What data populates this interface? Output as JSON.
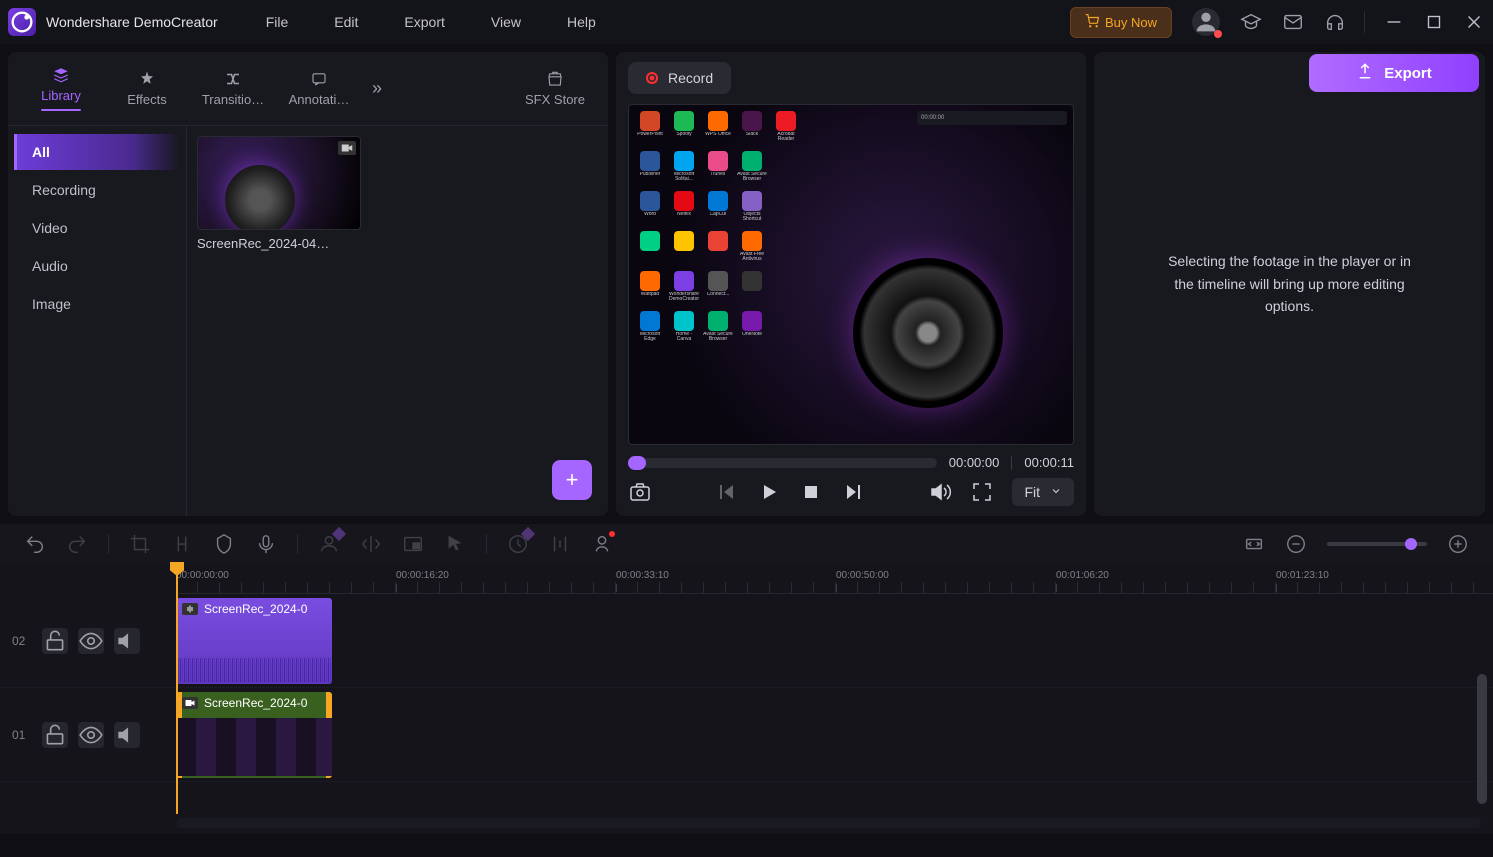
{
  "app": {
    "title": "Wondershare DemoCreator"
  },
  "menu": {
    "file": "File",
    "edit": "Edit",
    "export": "Export",
    "view": "View",
    "help": "Help"
  },
  "titlebar": {
    "buy": "Buy Now"
  },
  "export_btn": "Export",
  "tabs": {
    "library": "Library",
    "effects": "Effects",
    "transitions": "Transitio…",
    "annotations": "Annotati…",
    "sfx": "SFX Store"
  },
  "categories": {
    "all": "All",
    "recording": "Recording",
    "video": "Video",
    "audio": "Audio",
    "image": "Image"
  },
  "media": {
    "item1": "ScreenRec_2024-04…"
  },
  "record": {
    "label": "Record"
  },
  "player": {
    "current": "00:00:00",
    "total": "00:00:11",
    "fit": "Fit"
  },
  "properties": {
    "hint": "Selecting the footage in the player or in the timeline will bring up more editing options."
  },
  "ruler": {
    "t0": "00:00:00:00",
    "t1": "00:00:16:20",
    "t2": "00:00:33:10",
    "t3": "00:00:50:00",
    "t4": "00:01:06:20",
    "t5": "00:01:23:10"
  },
  "tracks": {
    "n2": "02",
    "n1": "01",
    "clip_audio": "ScreenRec_2024-0",
    "clip_video": "ScreenRec_2024-0"
  },
  "desktop_icons": [
    {
      "c": "#d24726",
      "l": "PowerPoint"
    },
    {
      "c": "#1db954",
      "l": "Spotify"
    },
    {
      "c": "#ff6a00",
      "l": "WPS Office"
    },
    {
      "c": "#4a154b",
      "l": "Slack"
    },
    {
      "c": "#ed1c24",
      "l": "Acrobat Reader"
    },
    {
      "c": "#2b579a",
      "l": "Publisher"
    },
    {
      "c": "#00a4ef",
      "l": "Microsoft Solitai..."
    },
    {
      "c": "#ea4c89",
      "l": "iTunes"
    },
    {
      "c": "#00b06f",
      "l": "Avast Secure Browser"
    },
    {
      "c": "",
      "l": ""
    },
    {
      "c": "#2b579a",
      "l": "Word"
    },
    {
      "c": "#e50914",
      "l": "Netflix"
    },
    {
      "c": "#0078d4",
      "l": "CapCut"
    },
    {
      "c": "#8661c5",
      "l": "Objects Shortcut"
    },
    {
      "c": "",
      "l": ""
    },
    {
      "c": "#00d084",
      "l": ""
    },
    {
      "c": "#ffc400",
      "l": ""
    },
    {
      "c": "#ea4335",
      "l": ""
    },
    {
      "c": "#ff6a00",
      "l": "Avast Free Antivirus"
    },
    {
      "c": "",
      "l": ""
    },
    {
      "c": "#ff6a00",
      "l": "Wattpad"
    },
    {
      "c": "#7b3fe4",
      "l": "Wondershare DemoCreator"
    },
    {
      "c": "#555",
      "l": "Connect..."
    },
    {
      "c": "#333",
      "l": ""
    },
    {
      "c": "",
      "l": ""
    },
    {
      "c": "#0078d4",
      "l": "Microsoft Edge"
    },
    {
      "c": "#00c4cc",
      "l": "Home - Canva"
    },
    {
      "c": "#00b06f",
      "l": "Avast Secure Browser"
    },
    {
      "c": "#7719aa",
      "l": "OneNote"
    },
    {
      "c": "",
      "l": ""
    }
  ]
}
